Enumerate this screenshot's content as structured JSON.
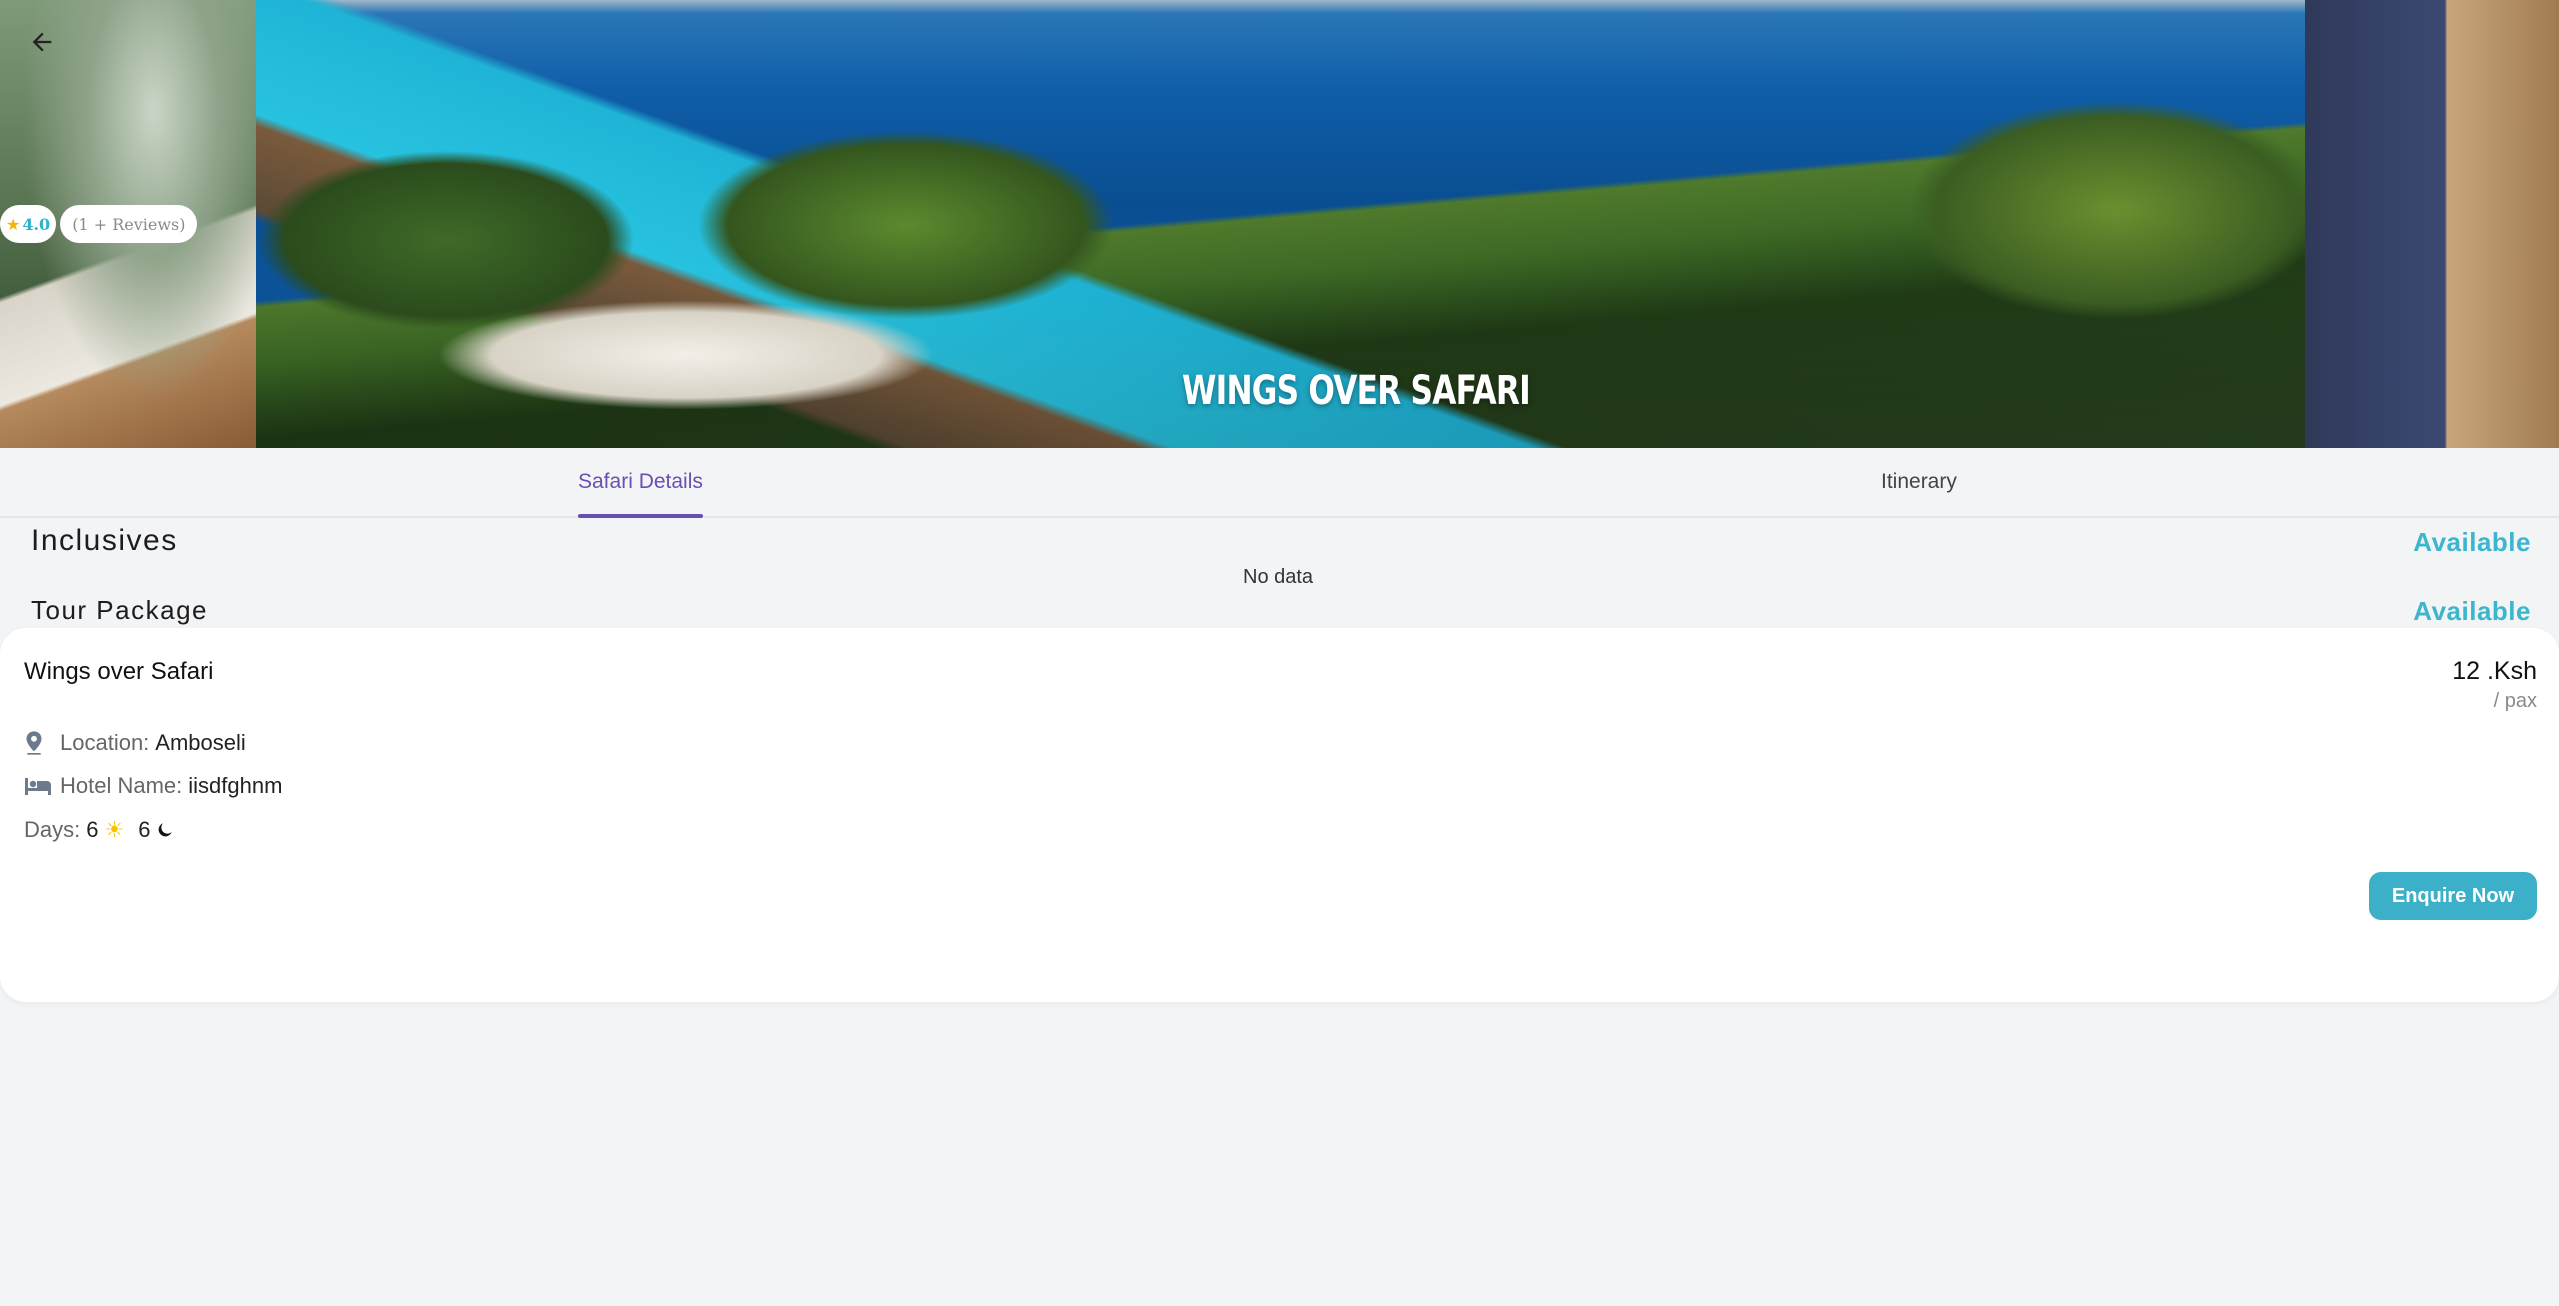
{
  "hero": {
    "title": "WINGS OVER SAFARI",
    "rating": {
      "score": "4.0",
      "reviews": "(1 + Reviews)"
    },
    "back_icon": "arrow-left-icon"
  },
  "tabs": [
    {
      "label": "Safari Details",
      "active": true
    },
    {
      "label": "Itinerary",
      "active": false
    }
  ],
  "inclusives": {
    "title": "Inclusives",
    "status": "Available",
    "empty_text": "No data"
  },
  "tour_package": {
    "title": "Tour Package",
    "status": "Available"
  },
  "package": {
    "name": "Wings over Safari",
    "price": "12 .Ksh",
    "price_unit": "/ pax",
    "location_label": "Location:",
    "location": "Amboseli",
    "hotel_label": "Hotel Name:",
    "hotel": "iisdfghnm",
    "days_label": "Days:",
    "days": "6",
    "nights": "6",
    "enquire_label": "Enquire Now"
  },
  "colors": {
    "accent": "#6a4fb3",
    "teal": "#3bb6cc",
    "background": "#f3f4f6"
  }
}
